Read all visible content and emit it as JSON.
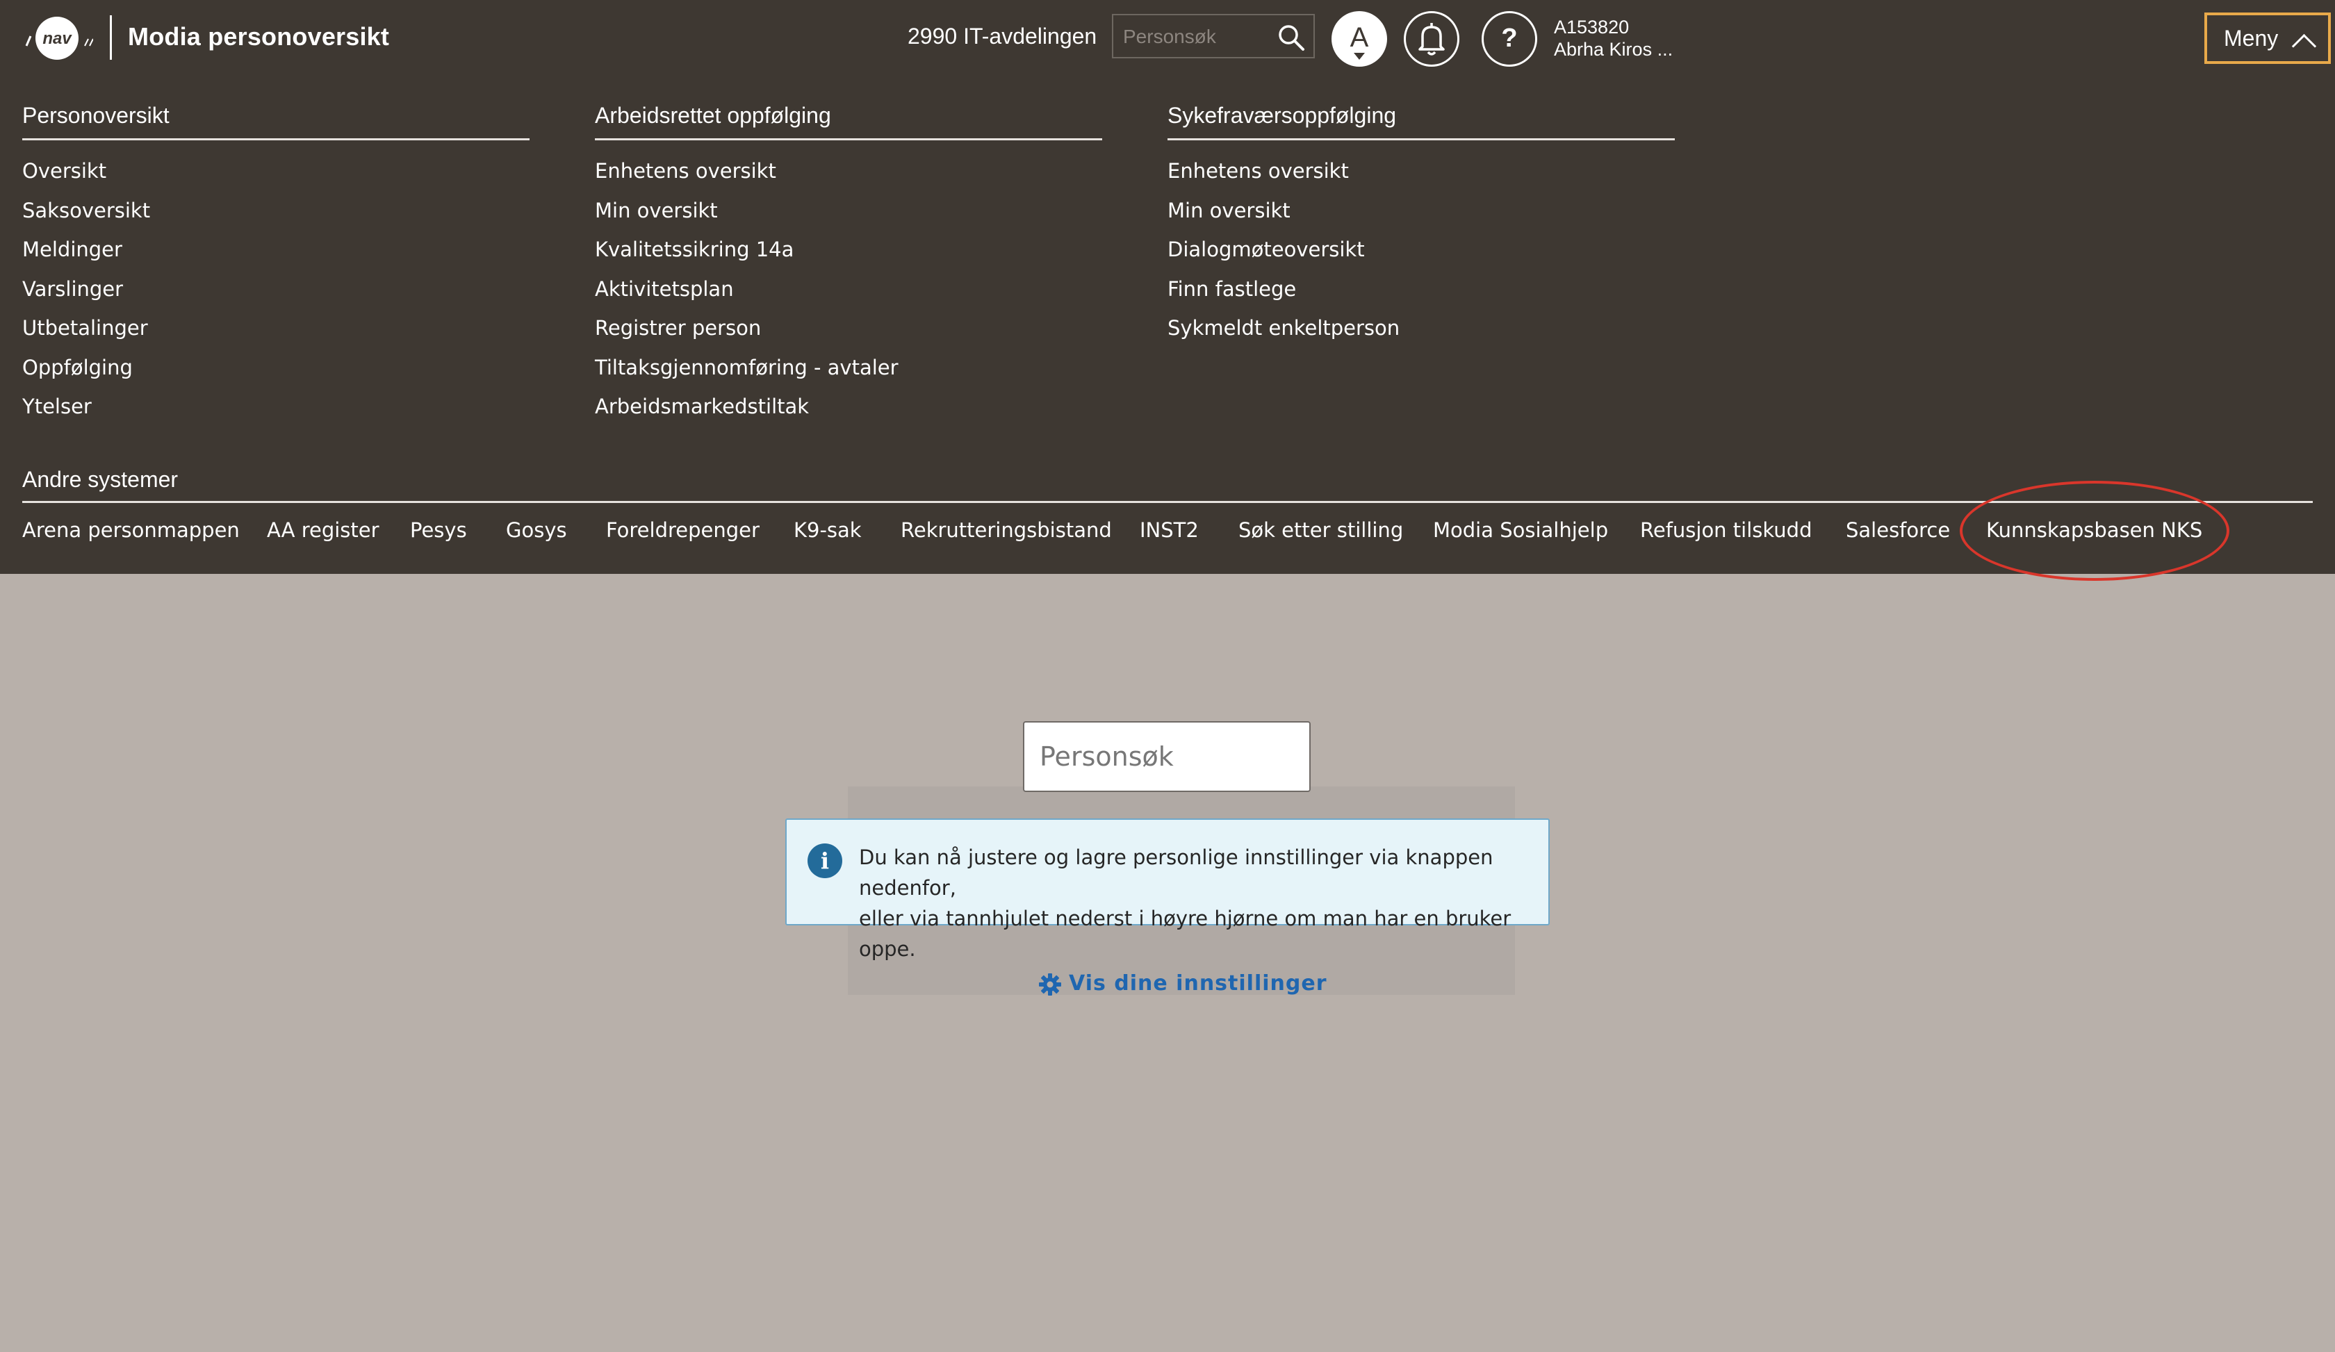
{
  "header": {
    "logo_text": "nav",
    "app_title": "Modia personoversikt",
    "enhet": "2990 IT-avdelingen",
    "search_placeholder": "Personsøk",
    "font_button_label": "A",
    "help_label": "?",
    "user_id": "A153820",
    "user_name": "Abrha Kiros ...",
    "menu_label": "Meny"
  },
  "menu": {
    "columns": [
      {
        "heading": "Personoversikt",
        "items": [
          "Oversikt",
          "Saksoversikt",
          "Meldinger",
          "Varslinger",
          "Utbetalinger",
          "Oppfølging",
          "Ytelser"
        ]
      },
      {
        "heading": "Arbeidsrettet oppfølging",
        "items": [
          "Enhetens oversikt",
          "Min oversikt",
          "Kvalitetssikring 14a",
          "Aktivitetsplan",
          "Registrer person",
          "Tiltaksgjennomføring - avtaler",
          "Arbeidsmarkedstiltak"
        ]
      },
      {
        "heading": "Sykefraværsoppfølging",
        "items": [
          "Enhetens oversikt",
          "Min oversikt",
          "Dialogmøteoversikt",
          "Finn fastlege",
          "Sykmeldt enkeltperson"
        ]
      }
    ],
    "andre_heading": "Andre systemer",
    "andre_items": [
      "Arena personmappen",
      "AA register",
      "Pesys",
      "Gosys",
      "Foreldrepenger",
      "K9-sak",
      "Rekrutteringsbistand",
      "INST2",
      "Søk etter stilling",
      "Modia Sosialhjelp",
      "Refusjon tilskudd",
      "Salesforce",
      "Kunnskapsbasen NKS"
    ]
  },
  "main": {
    "search_placeholder": "Personsøk",
    "info_icon": "i",
    "info_line1": "Du kan nå justere og lagre personlige innstillinger via knappen nedenfor,",
    "info_line2": "eller via tannhjulet nederst i høyre hjørne om man har en bruker oppe.",
    "settings_link": "Vis dine innstillinger"
  },
  "colors": {
    "header_bg": "#3e3832",
    "page_bg": "#b8b0aa",
    "menu_accent": "#e8a94a",
    "annotation": "#d9362b",
    "link": "#1f66b0"
  }
}
